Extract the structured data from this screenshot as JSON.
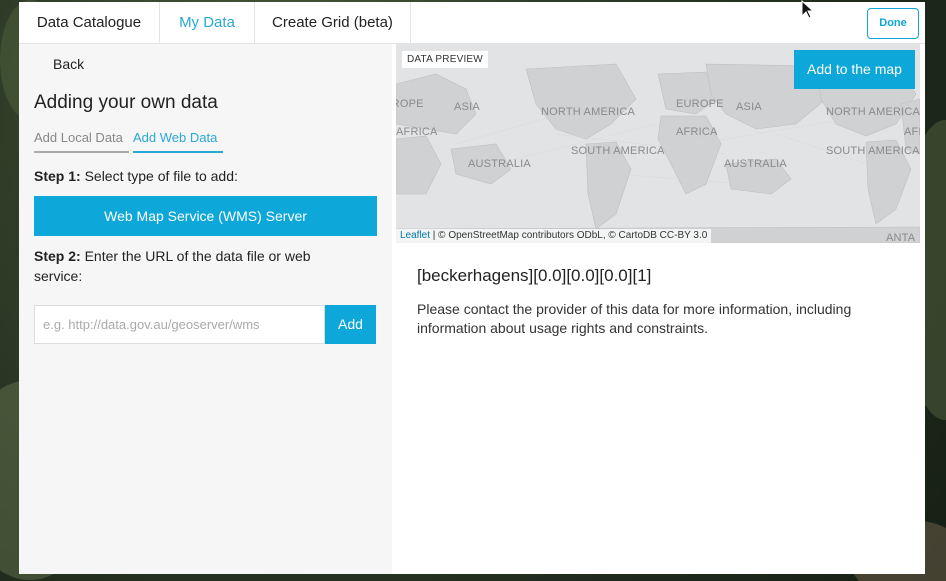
{
  "tabs": [
    {
      "label": "Data Catalogue"
    },
    {
      "label": "My Data"
    },
    {
      "label": "Create Grid (beta)"
    }
  ],
  "done_label": "Done",
  "left": {
    "back_label": "Back",
    "heading": "Adding your own data",
    "subtabs": [
      {
        "label": "Add Local Data"
      },
      {
        "label": "Add Web Data"
      }
    ],
    "step1": {
      "prefix": "Step 1:",
      "text": " Select type of file to add:"
    },
    "wms_button": "Web Map Service (WMS) Server",
    "step2": {
      "prefix": "Step 2:",
      "text": " Enter the URL of the data file or web service:"
    },
    "url_input": {
      "value": "",
      "placeholder": "e.g. http://data.gov.au/geoserver/wms"
    },
    "add_button": "Add"
  },
  "preview": {
    "tag": "DATA PREVIEW",
    "add_to_map": "Add to the map",
    "map_labels": [
      "EUROPE",
      "ASIA",
      "NORTH AMERICA",
      "EUROPE",
      "ASIA",
      "NORTH AMERICA",
      "AFRICA",
      "AFRICA",
      "AFRICA",
      "SOUTH AMERICA",
      "SOUTH AMERICA",
      "AUSTRALIA",
      "AUSTRALIA",
      "ANTA"
    ],
    "attribution": {
      "leaflet": "Leaflet",
      "rest": " | © OpenStreetMap contributors ODbL, © CartoDB CC-BY 3.0"
    }
  },
  "data": {
    "title": "[beckerhagens][0.0][0.0][0.0][1]",
    "description": "Please contact the provider of this data for more information, including information about usage rights and constraints."
  },
  "colors": {
    "accent": "#0ea7d9",
    "map_land": "#cfd1d3",
    "map_sea": "#e2e3e4"
  }
}
